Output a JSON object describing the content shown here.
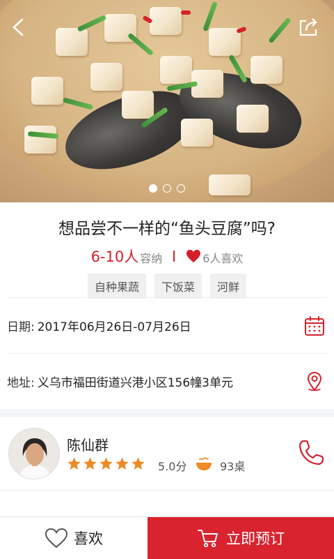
{
  "dish": {
    "title": "想品尝不一样的“鱼头豆腐”吗?",
    "people": "6-10人",
    "capacity_label": "容纳",
    "likes": "6人喜欢",
    "tags": [
      "自种果蔬",
      "下饭菜",
      "河鲜"
    ]
  },
  "carousel": {
    "total": 3,
    "active": 0
  },
  "info": {
    "date_label": "日期:",
    "date_value": "2017年06月26日-07月26日",
    "address_label": "地址:",
    "address_value": "义乌市福田街道兴港小区156幢3单元"
  },
  "host": {
    "name": "陈仙群",
    "rating": 5,
    "score": "5.0分",
    "tables": "93桌"
  },
  "bottom": {
    "like_label": "喜欢",
    "book_label": "立即预订"
  },
  "colors": {
    "accent": "#d9232e",
    "star": "#f08a24",
    "icon_red": "#d5202b"
  },
  "icons": [
    "back-icon",
    "share-icon",
    "calendar-icon",
    "location-icon",
    "phone-icon",
    "bowl-icon",
    "heart-icon",
    "cart-icon",
    "star-icon"
  ]
}
